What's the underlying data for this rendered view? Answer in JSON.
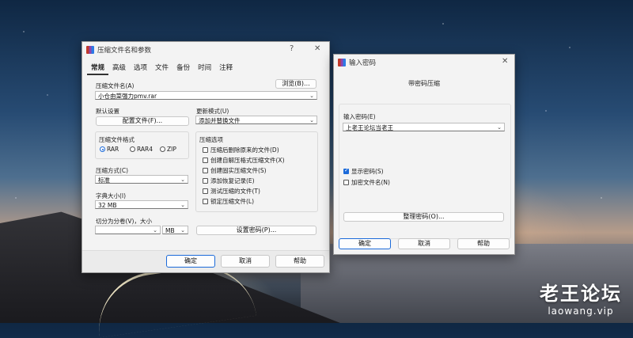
{
  "main_dialog": {
    "title": "压缩文件名和参数",
    "help_glyph": "?",
    "close_glyph": "✕",
    "tabs": [
      "常规",
      "高级",
      "选项",
      "文件",
      "备份",
      "时间",
      "注释"
    ],
    "archive_name_label": "压缩文件名(A)",
    "browse_label": "浏览(B)...",
    "archive_name_value": "小仓由菜强力pmv.rar",
    "default_settings_label": "默认设置",
    "profiles_label": "配置文件(F)...",
    "update_mode_label": "更新模式(U)",
    "update_mode_value": "添加并替换文件",
    "format_group_label": "压缩文件格式",
    "formats": [
      {
        "label": "RAR",
        "selected": true
      },
      {
        "label": "RAR4",
        "selected": false
      },
      {
        "label": "ZIP",
        "selected": false
      }
    ],
    "method_label": "压缩方式(C)",
    "method_value": "标准",
    "dict_label": "字典大小(I)",
    "dict_value": "32 MB",
    "split_label": "切分为分卷(V)，大小",
    "split_value": "",
    "split_unit": "MB",
    "options_group_label": "压缩选项",
    "options": [
      {
        "label": "压缩后删除原来的文件(D)",
        "checked": false
      },
      {
        "label": "创建自解压格式压缩文件(X)",
        "checked": false
      },
      {
        "label": "创建固实压缩文件(S)",
        "checked": false
      },
      {
        "label": "添加恢复记录(E)",
        "checked": false
      },
      {
        "label": "测试压缩的文件(T)",
        "checked": false
      },
      {
        "label": "锁定压缩文件(L)",
        "checked": false
      }
    ],
    "set_password_label": "设置密码(P)...",
    "ok_label": "确定",
    "cancel_label": "取消",
    "help_label": "帮助"
  },
  "password_dialog": {
    "title": "输入密码",
    "close_glyph": "✕",
    "heading": "带密码压缩",
    "password_label": "输入密码(E)",
    "password_value": "上老王论坛当老王",
    "show_password_label": "显示密码(S)",
    "show_password_checked": true,
    "encrypt_names_label": "加密文件名(N)",
    "encrypt_names_checked": false,
    "organize_label": "整理密码(O)...",
    "ok_label": "确定",
    "cancel_label": "取消",
    "help_label": "帮助"
  },
  "watermark": {
    "brand": "老王论坛",
    "url": "laowang.vip"
  },
  "icons": {
    "dropdown": "chevron-down-icon",
    "app": "winrar-icon"
  }
}
